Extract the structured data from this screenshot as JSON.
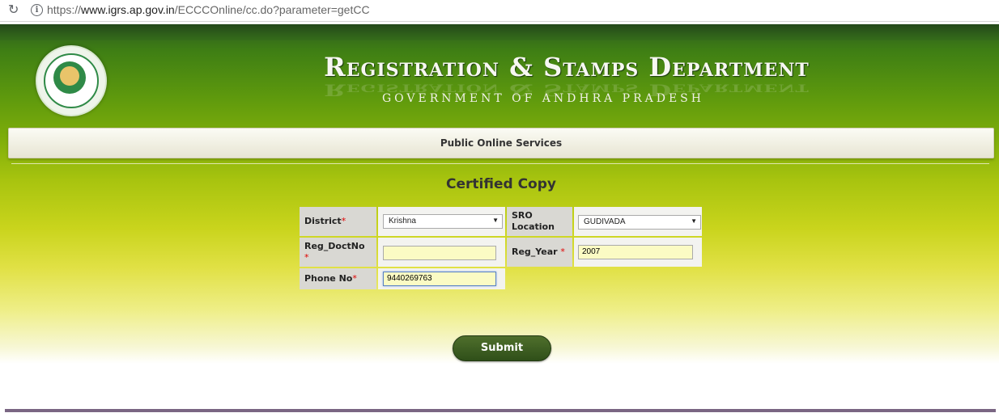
{
  "browser": {
    "url_prefix": "https://",
    "url_host": "www.igrs.ap.gov.in",
    "url_path": "/ECCCOnline/cc.do?parameter=getCC"
  },
  "header": {
    "title": "Registration & Stamps Department",
    "subtitle": "GOVERNMENT OF ANDHRA PRADESH"
  },
  "nav": {
    "label": "Public Online Services"
  },
  "form": {
    "heading": "Certified Copy",
    "district_label": "District",
    "district_value": "Krishna",
    "sro_label": "SRO Location",
    "sro_value": "GUDIVADA",
    "doctno_label": "Reg_DoctNo",
    "doctno_value": "",
    "regyear_label": "Reg_Year",
    "regyear_value": "2007",
    "phone_label": "Phone No",
    "phone_value": "9440269763",
    "required_mark": "*",
    "submit_label": "Submit"
  },
  "colors": {
    "required": "#e00000",
    "submit_bg": "#3a5a20",
    "input_bg": "#fbfbc4"
  }
}
